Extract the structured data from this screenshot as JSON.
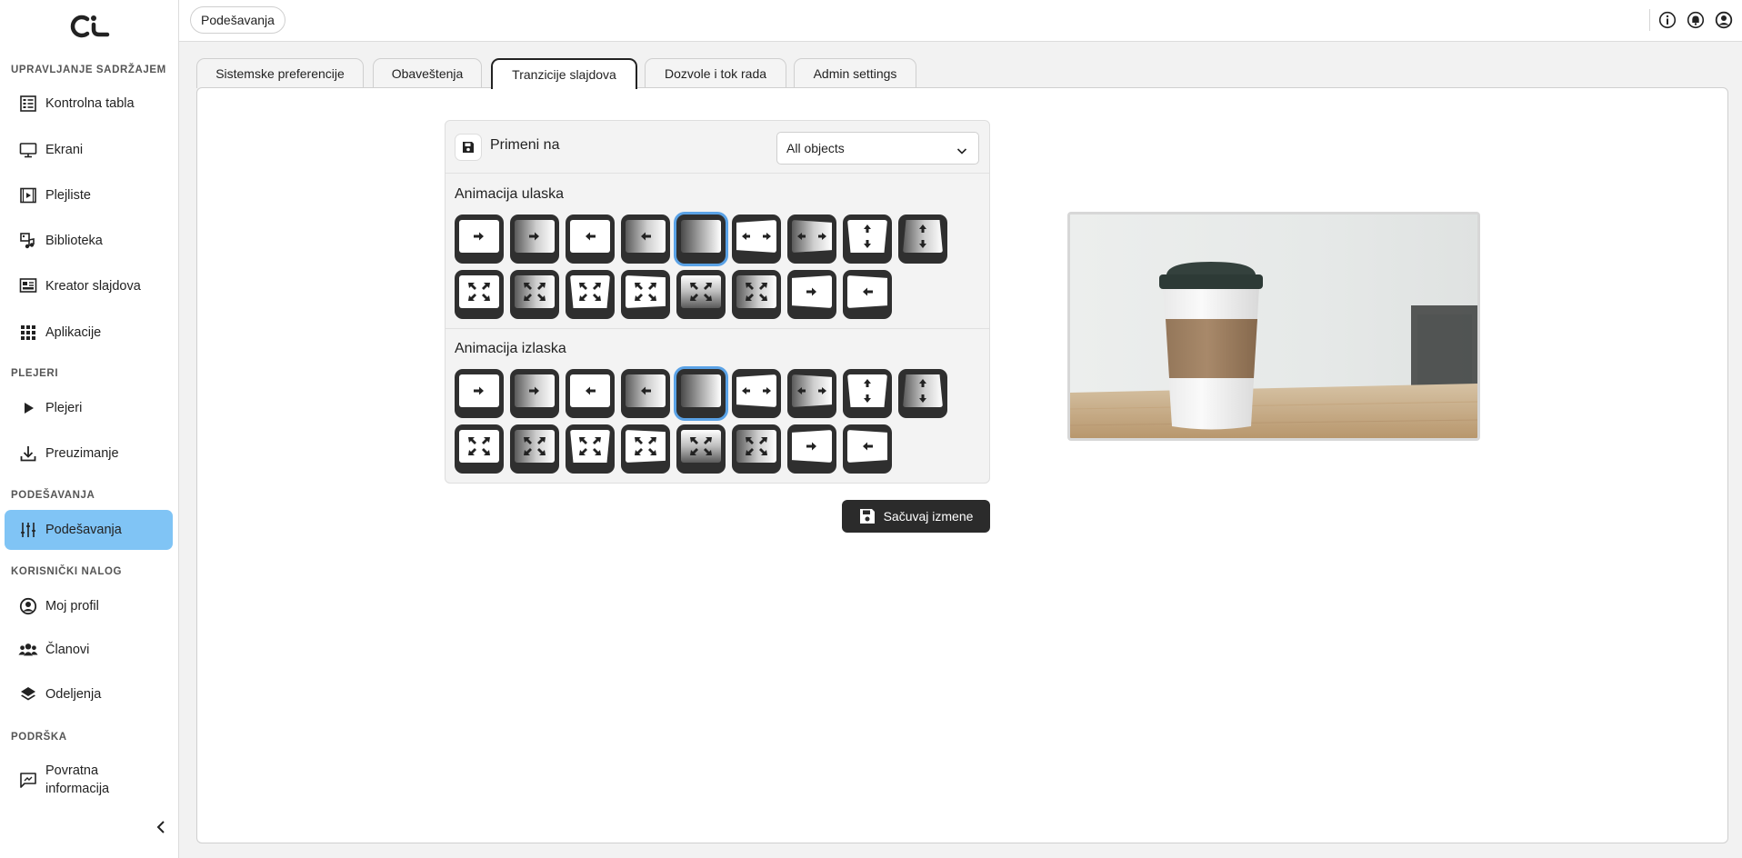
{
  "sidebar": {
    "sections": {
      "content": "UPRAVLJANJE SADRŽAJEM",
      "players": "PLEJERI",
      "settings": "PODEŠAVANJA",
      "account": "KORISNIČKI NALOG",
      "support": "PODRŠKA"
    },
    "items": {
      "dashboard": "Kontrolna tabla",
      "screens": "Ekrani",
      "playlists": "Plejliste",
      "library": "Biblioteka",
      "slide_creator": "Kreator slajdova",
      "apps": "Aplikacije",
      "players": "Plejeri",
      "download": "Preuzimanje",
      "settings": "Podešavanja",
      "profile": "Moj profil",
      "members": "Članovi",
      "departments": "Odeljenja",
      "feedback_line1": "Povratna",
      "feedback_line2": "informacija"
    }
  },
  "topbar": {
    "breadcrumb": "Podešavanja"
  },
  "tabs": {
    "system": "Sistemske preferencije",
    "notifications": "Obaveštenja",
    "transitions": "Tranzicije slajdova",
    "permissions": "Dozvole i tok rada",
    "admin": "Admin settings"
  },
  "card": {
    "apply_label": "Primeni na",
    "apply_value": "All objects",
    "entry_title": "Animacija ulaska",
    "exit_title": "Animacija izlaska",
    "selected_index": 4
  },
  "save_button": "Sačuvaj izmene",
  "colors": {
    "accent": "#80c4f5",
    "selection": "#5aa2e6",
    "dark": "#2b2b2b"
  }
}
